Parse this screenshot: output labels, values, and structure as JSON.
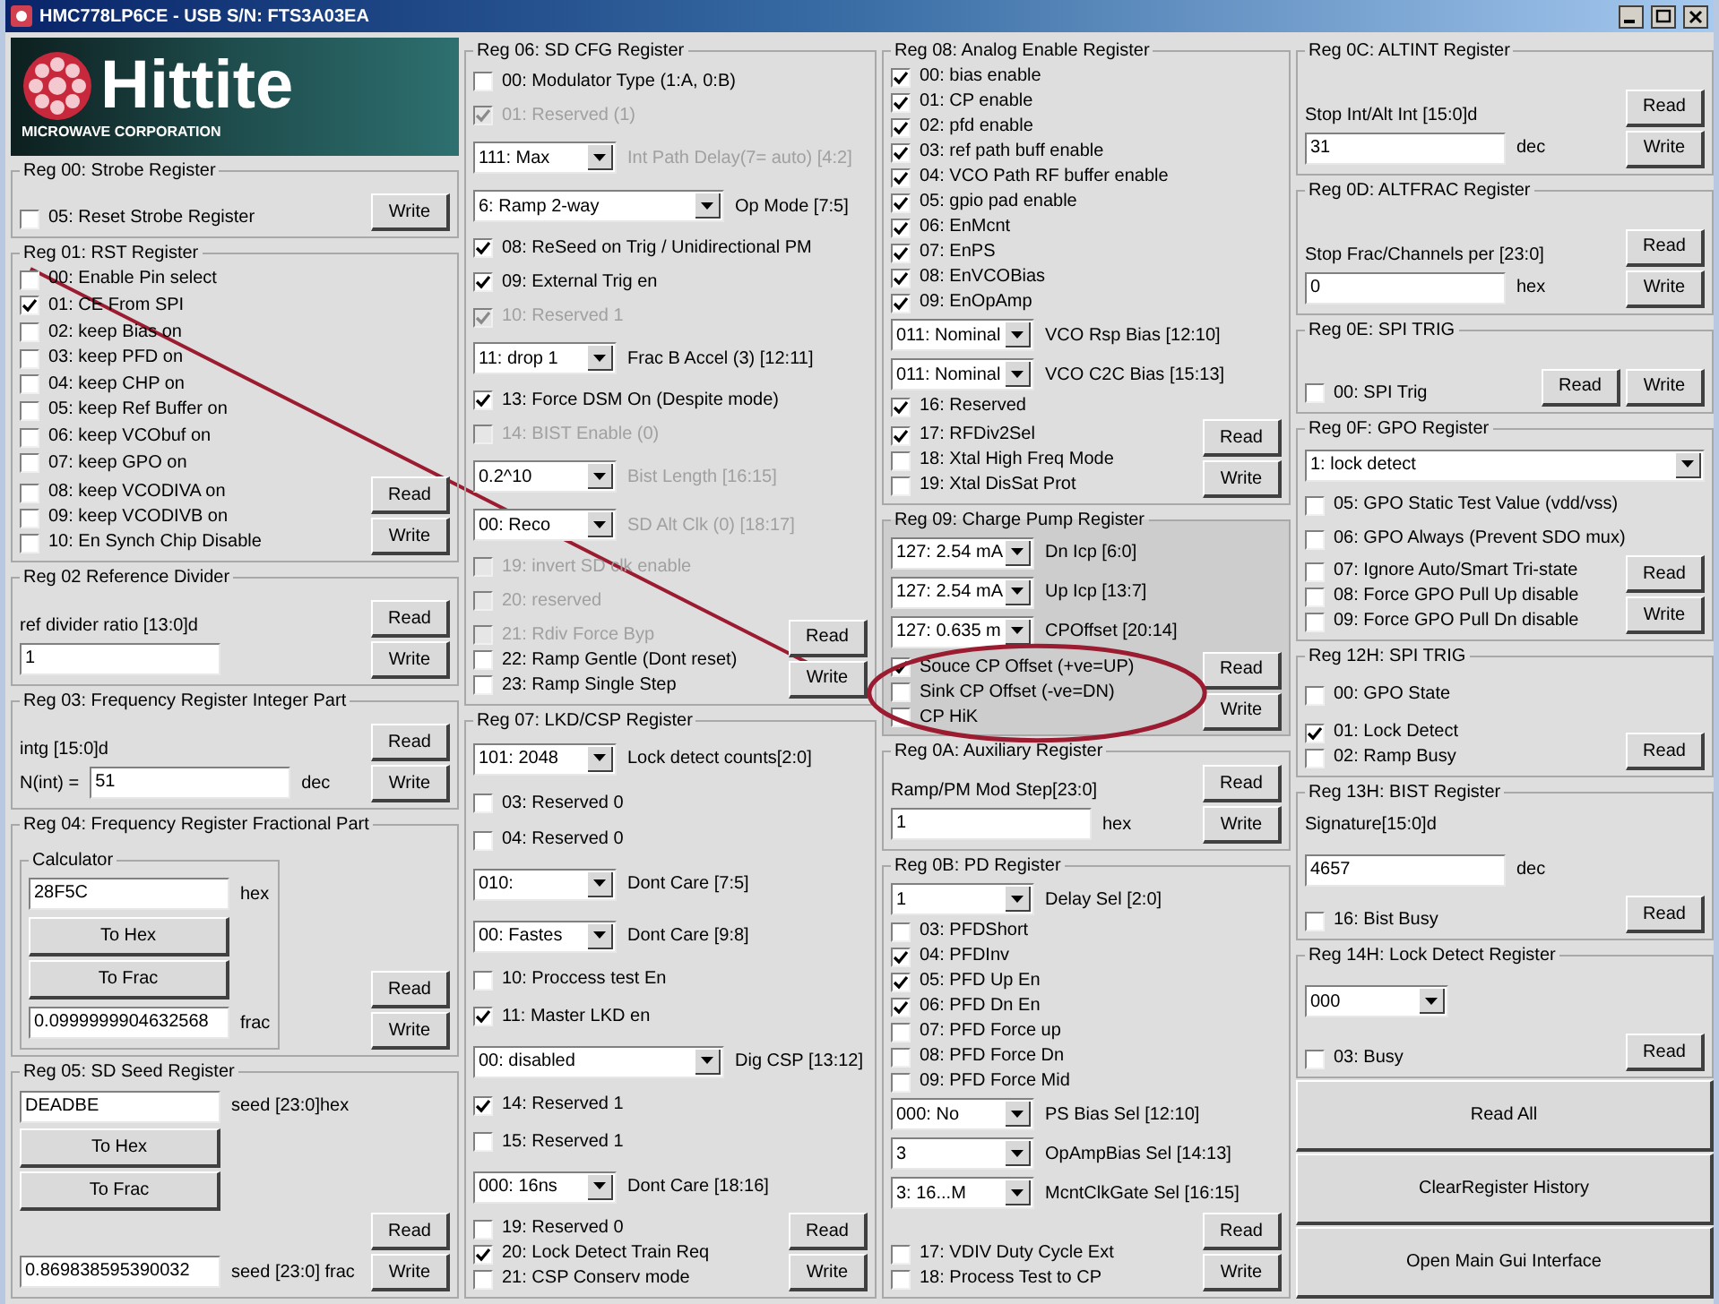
{
  "window": {
    "title": "HMC778LP6CE - USB S/N: FTS3A03EA"
  },
  "columns": [
    {
      "logo": {
        "name": "Hittite",
        "tagline": "MICROWAVE CORPORATION"
      },
      "groups": [
        {
          "title": "Reg 00: Strobe Register",
          "rows": [
            {
              "kind": "checkbox",
              "label": "05: Reset Strobe Register",
              "checked": false
            }
          ],
          "buttons": [
            "Write"
          ]
        },
        {
          "title": "Reg 01: RST Register",
          "rows": [
            {
              "kind": "checkbox",
              "label": "00: Enable Pin select",
              "checked": false
            },
            {
              "kind": "checkbox",
              "label": "01: CE From SPI",
              "checked": true
            },
            {
              "kind": "checkbox",
              "label": "02: keep Bias on",
              "checked": false
            },
            {
              "kind": "checkbox",
              "label": "03: keep PFD on",
              "checked": false
            },
            {
              "kind": "checkbox",
              "label": "04: keep CHP on",
              "checked": false
            },
            {
              "kind": "checkbox",
              "label": "05: keep Ref Buffer on",
              "checked": false
            },
            {
              "kind": "checkbox",
              "label": "06: keep VCObuf on",
              "checked": false
            },
            {
              "kind": "checkbox",
              "label": "07: keep GPO on",
              "checked": false
            },
            {
              "kind": "checkbox",
              "label": "08: keep VCODIVA on",
              "checked": false
            },
            {
              "kind": "checkbox",
              "label": "09: keep VCODIVB on",
              "checked": false
            },
            {
              "kind": "checkbox",
              "label": "10: En Synch Chip Disable",
              "checked": false
            }
          ],
          "buttons": [
            "Read",
            "Write"
          ]
        },
        {
          "title": "Reg 02 Reference Divider",
          "rows": [
            {
              "kind": "text",
              "label": "ref divider ratio [13:0]d"
            },
            {
              "kind": "field",
              "value": "1"
            }
          ],
          "buttons": [
            "Read",
            "Write"
          ]
        },
        {
          "title": "Reg 03: Frequency Register  Integer Part",
          "rows": [
            {
              "kind": "text",
              "label": "intg [15:0]d"
            },
            {
              "kind": "field",
              "prefix": "N(int) =",
              "value": "51",
              "unit": "dec"
            }
          ],
          "buttons": [
            "Read",
            "Write"
          ]
        },
        {
          "title": "Reg 04: Frequency Register Fractional Part",
          "rows": [
            {
              "kind": "group",
              "title": "Calculator",
              "rows": [
                {
                  "kind": "field",
                  "value": "28F5C",
                  "unit": "hex"
                },
                {
                  "kind": "button",
                  "label": "To Hex"
                },
                {
                  "kind": "button",
                  "label": "To Frac"
                },
                {
                  "kind": "field",
                  "value": "0.0999999904632568",
                  "unit": "frac"
                }
              ]
            }
          ],
          "buttons": [
            "Read",
            "Write"
          ]
        },
        {
          "title": "Reg 05: SD Seed Register",
          "rows": [
            {
              "kind": "field",
              "value": "DEADBE",
              "unit": "seed [23:0]hex"
            },
            {
              "kind": "button",
              "label": "To Hex"
            },
            {
              "kind": "button",
              "label": "To Frac"
            },
            {
              "kind": "field",
              "value": "0.869838595390032",
              "unit": "seed [23:0] frac"
            }
          ],
          "buttons": [
            "Read",
            "Write"
          ]
        }
      ]
    },
    {
      "groups": [
        {
          "title": "Reg 06: SD CFG Register",
          "rows": [
            {
              "kind": "checkbox",
              "label": "00: Modulator Type (1:A, 0:B)",
              "checked": false,
              "disabled": false
            },
            {
              "kind": "checkbox",
              "label": "01: Reserved (1)",
              "checked": true,
              "disabled": true
            },
            {
              "kind": "select",
              "option": "111: Max",
              "label": "Int Path Delay(7= auto) [4:2]",
              "disabled": true
            },
            {
              "kind": "select-wide",
              "option": "6: Ramp 2-way",
              "label": "Op Mode [7:5]",
              "disabled": false
            },
            {
              "kind": "checkbox",
              "label": "08: ReSeed on Trig / Unidirectional PM",
              "checked": true,
              "disabled": false
            },
            {
              "kind": "checkbox",
              "label": "09: External Trig en",
              "checked": true,
              "disabled": false
            },
            {
              "kind": "checkbox",
              "label": "10: Reserved 1",
              "checked": true,
              "disabled": true
            },
            {
              "kind": "select",
              "option": "11: drop 1",
              "label": "Frac B Accel (3) [12:11]",
              "disabled": false
            },
            {
              "kind": "checkbox",
              "label": "13: Force DSM On (Despite mode)",
              "checked": true,
              "disabled": false
            },
            {
              "kind": "checkbox",
              "label": "14: BIST Enable (0)",
              "checked": false,
              "disabled": true
            },
            {
              "kind": "select",
              "option": "0.2^10",
              "label": "Bist Length [16:15]",
              "disabled": true
            },
            {
              "kind": "select",
              "option": "00: Reco",
              "label": "SD Alt Clk (0) [18:17]",
              "disabled": true
            },
            {
              "kind": "checkbox",
              "label": "19: invert SD clk enable",
              "checked": false,
              "disabled": true
            },
            {
              "kind": "checkbox",
              "label": "20: reserved",
              "checked": false,
              "disabled": true
            },
            {
              "kind": "checkbox",
              "label": "21: Rdiv Force Byp",
              "checked": false,
              "disabled": true
            },
            {
              "kind": "checkbox",
              "label": "22: Ramp Gentle (Dont reset)",
              "checked": false,
              "disabled": false
            },
            {
              "kind": "checkbox",
              "label": "23: Ramp Single Step",
              "checked": false,
              "disabled": false
            }
          ],
          "buttons": [
            "Read",
            "Write"
          ]
        },
        {
          "title": "Reg 07: LKD/CSP Register",
          "rows": [
            {
              "kind": "select",
              "option": "101: 2048",
              "label": "Lock detect counts[2:0]"
            },
            {
              "kind": "checkbox",
              "label": "03: Reserved 0",
              "checked": false
            },
            {
              "kind": "checkbox",
              "label": "04: Reserved 0",
              "checked": false
            },
            {
              "kind": "select",
              "option": "010:",
              "label": "Dont Care [7:5]"
            },
            {
              "kind": "select",
              "option": "00: Fastes",
              "label": "Dont Care [9:8]"
            },
            {
              "kind": "checkbox",
              "label": "10:  Proccess test En",
              "checked": false
            },
            {
              "kind": "checkbox",
              "label": "11: Master LKD en",
              "checked": true
            },
            {
              "kind": "select-wide",
              "option": "00: disabled",
              "label": "Dig CSP [13:12]"
            },
            {
              "kind": "checkbox",
              "label": "14: Reserved 1",
              "checked": true
            },
            {
              "kind": "checkbox",
              "label": "15: Reserved 1",
              "checked": false
            },
            {
              "kind": "select",
              "option": "000: 16ns",
              "label": "Dont Care [18:16]"
            },
            {
              "kind": "checkbox",
              "label": "19: Reserved 0",
              "checked": false
            },
            {
              "kind": "checkbox",
              "label": "20: Lock Detect Train Req",
              "checked": true
            },
            {
              "kind": "checkbox",
              "label": "21: CSP Conserv mode",
              "checked": false
            }
          ],
          "buttons": [
            "Read",
            "Write"
          ]
        }
      ]
    },
    {
      "groups": [
        {
          "title": "Reg 08: Analog Enable Register",
          "rows": [
            {
              "kind": "checkbox",
              "label": "00: bias enable",
              "checked": true
            },
            {
              "kind": "checkbox",
              "label": "01: CP enable",
              "checked": true
            },
            {
              "kind": "checkbox",
              "label": "02: pfd enable",
              "checked": true
            },
            {
              "kind": "checkbox",
              "label": "03: ref path  buff enable",
              "checked": true
            },
            {
              "kind": "checkbox",
              "label": "04: VCO Path RF buffer enable",
              "checked": true
            },
            {
              "kind": "checkbox",
              "label": "05: gpio pad enable",
              "checked": true
            },
            {
              "kind": "checkbox",
              "label": "06: EnMcnt",
              "checked": true
            },
            {
              "kind": "checkbox",
              "label": "07: EnPS",
              "checked": true
            },
            {
              "kind": "checkbox",
              "label": "08: EnVCOBias",
              "checked": true
            },
            {
              "kind": "checkbox",
              "label": "09: EnOpAmp",
              "checked": true
            },
            {
              "kind": "select",
              "option": "011: Nominal",
              "label": "VCO Rsp Bias [12:10]"
            },
            {
              "kind": "select",
              "option": "011: Nominal",
              "label": "VCO C2C Bias [15:13]"
            },
            {
              "kind": "checkbox",
              "label": "16: Reserved",
              "checked": true
            },
            {
              "kind": "checkbox",
              "label": "17: RFDiv2Sel",
              "checked": true
            },
            {
              "kind": "checkbox",
              "label": "18: Xtal High Freq Mode",
              "checked": false
            },
            {
              "kind": "checkbox",
              "label": "19: Xtal DisSat Prot",
              "checked": false
            }
          ],
          "buttons": [
            "Read",
            "Write"
          ]
        },
        {
          "title": "Reg 09: Charge Pump Register",
          "shaded": true,
          "callout": true,
          "rows": [
            {
              "kind": "select",
              "option": "127: 2.54 mA",
              "label": "Dn Icp [6:0]"
            },
            {
              "kind": "select",
              "option": "127: 2.54 mA",
              "label": "Up Icp [13:7]"
            },
            {
              "kind": "select",
              "option": "127: 0.635 m",
              "label": "CPOffset [20:14]"
            },
            {
              "kind": "checkbox",
              "label": "Souce CP Offset (+ve=UP)",
              "checked": true
            },
            {
              "kind": "checkbox",
              "label": "Sink CP Offset (-ve=DN)",
              "checked": false
            },
            {
              "kind": "checkbox",
              "label": "CP HiK",
              "checked": false
            }
          ],
          "buttons": [
            "Read",
            "Write"
          ]
        },
        {
          "title": "Reg 0A: Auxiliary Register",
          "rows": [
            {
              "kind": "text",
              "label": "Ramp/PM Mod Step[23:0]"
            },
            {
              "kind": "field",
              "value": "1",
              "unit": "hex"
            }
          ],
          "buttons": [
            "Read",
            "Write"
          ]
        },
        {
          "title": "Reg 0B: PD Register",
          "rows": [
            {
              "kind": "select",
              "option": "1",
              "label": "Delay Sel [2:0]"
            },
            {
              "kind": "checkbox",
              "label": "03: PFDShort",
              "checked": false
            },
            {
              "kind": "checkbox",
              "label": "04: PFDInv",
              "checked": true
            },
            {
              "kind": "checkbox",
              "label": "05: PFD Up En",
              "checked": true
            },
            {
              "kind": "checkbox",
              "label": "06: PFD Dn En",
              "checked": true
            },
            {
              "kind": "checkbox",
              "label": "07: PFD Force up",
              "checked": false
            },
            {
              "kind": "checkbox",
              "label": "08: PFD Force Dn",
              "checked": false
            },
            {
              "kind": "checkbox",
              "label": "09: PFD Force Mid",
              "checked": false
            },
            {
              "kind": "select",
              "option": "000: No",
              "label": "PS Bias Sel [12:10]"
            },
            {
              "kind": "select",
              "option": "3",
              "label": "OpAmpBias Sel [14:13]"
            },
            {
              "kind": "select",
              "option": "3: 16...M",
              "label": "McntClkGate Sel [16:15]"
            },
            {
              "kind": "checkbox",
              "label": "17: VDIV Duty Cycle Ext",
              "checked": false
            },
            {
              "kind": "checkbox",
              "label": "18: Process Test to CP",
              "checked": false
            }
          ],
          "buttons": [
            "Read",
            "Write"
          ]
        }
      ]
    },
    {
      "groups": [
        {
          "title": "Reg 0C: ALTINT Register",
          "rows": [
            {
              "kind": "text",
              "label": "Stop Int/Alt Int [15:0]d"
            },
            {
              "kind": "field",
              "value": "31",
              "unit": "dec"
            }
          ],
          "buttons": [
            "Read",
            "Write"
          ]
        },
        {
          "title": "Reg 0D: ALTFRAC Register",
          "rows": [
            {
              "kind": "text",
              "label": "Stop Frac/Channels per  [23:0]"
            },
            {
              "kind": "field",
              "value": "0",
              "unit": "hex"
            }
          ],
          "buttons": [
            "Read",
            "Write"
          ]
        },
        {
          "title": "Reg 0E: SPI TRIG",
          "rows": [
            {
              "kind": "checkbox",
              "label": "00: SPI Trig",
              "checked": false
            }
          ],
          "buttons": [
            "Read",
            "Write"
          ]
        },
        {
          "title": "Reg 0F: GPO Register",
          "rows": [
            {
              "kind": "select-full",
              "option": "1: lock detect"
            },
            {
              "kind": "checkbox",
              "label": "05: GPO Static Test Value (vdd/vss)",
              "checked": false
            },
            {
              "kind": "checkbox",
              "label": "06: GPO Always (Prevent SDO mux)",
              "checked": false
            },
            {
              "kind": "checkbox",
              "label": "07: Ignore Auto/Smart Tri-state",
              "checked": false
            },
            {
              "kind": "checkbox",
              "label": "08: Force GPO Pull Up disable",
              "checked": false
            },
            {
              "kind": "checkbox",
              "label": "09: Force GPO Pull Dn disable",
              "checked": false
            }
          ],
          "buttons": [
            "Read",
            "Write"
          ]
        },
        {
          "title": "Reg 12H: SPI TRIG",
          "rows": [
            {
              "kind": "checkbox",
              "label": "00: GPO State",
              "checked": false
            },
            {
              "kind": "checkbox",
              "label": "01: Lock Detect",
              "checked": true
            },
            {
              "kind": "checkbox",
              "label": "02: Ramp Busy",
              "checked": false
            }
          ],
          "buttons": [
            "Read"
          ]
        },
        {
          "title": "Reg 13H: BIST Register",
          "rows": [
            {
              "kind": "text",
              "label": "Signature[15:0]d"
            },
            {
              "kind": "field",
              "value": "4657",
              "unit": "dec"
            },
            {
              "kind": "checkbox",
              "label": "16: Bist Busy",
              "checked": false
            }
          ],
          "buttons": [
            "Read"
          ]
        },
        {
          "title": "Reg 14H:  Lock Detect Register",
          "rows": [
            {
              "kind": "select",
              "option": "000"
            },
            {
              "kind": "checkbox",
              "label": "03: Busy",
              "checked": false
            }
          ],
          "buttons": [
            "Read"
          ]
        }
      ],
      "actions": [
        "Read All",
        "ClearRegister History",
        "Open Main Gui Interface"
      ]
    }
  ]
}
